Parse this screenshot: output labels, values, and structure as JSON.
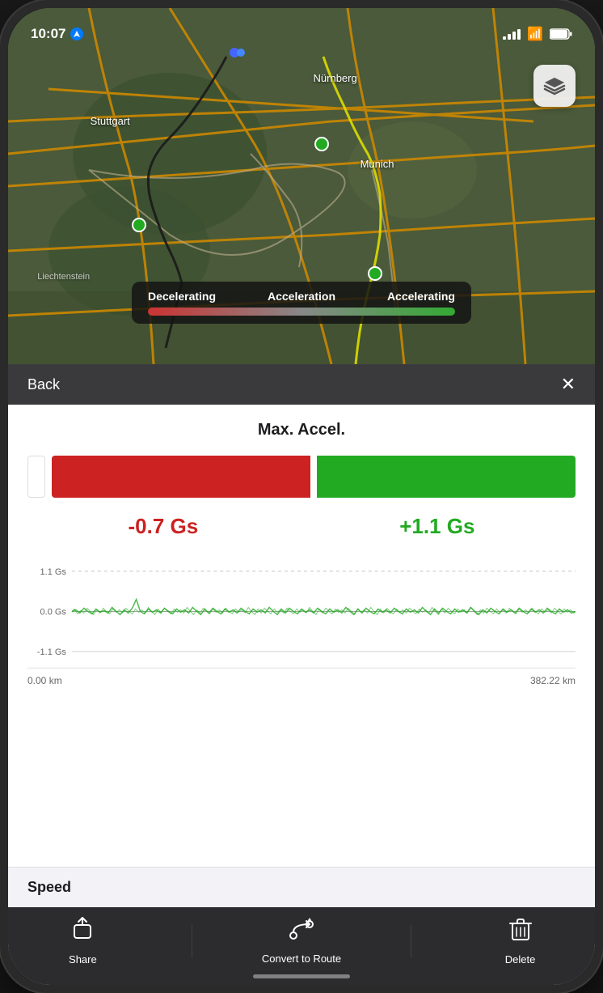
{
  "status_bar": {
    "time": "10:07",
    "signal_label": "signal",
    "wifi_label": "wifi",
    "battery_label": "battery"
  },
  "map": {
    "layers_button_label": "layers",
    "legend": {
      "decelerating": "Decelerating",
      "acceleration": "Acceleration",
      "accelerating": "Accelerating"
    },
    "city_labels": [
      {
        "name": "Nürnberg",
        "left": "52%",
        "top": "20%"
      },
      {
        "name": "Stuttgart",
        "left": "14%",
        "top": "30%"
      },
      {
        "name": "Munich",
        "left": "60%",
        "top": "42%"
      },
      {
        "name": "Liechtenstein",
        "left": "12%",
        "top": "76%"
      }
    ]
  },
  "panel_header": {
    "back_label": "Back",
    "close_label": "✕"
  },
  "accel_section": {
    "title": "Max. Accel.",
    "negative_value": "-0.7 Gs",
    "positive_value": "+1.1 Gs"
  },
  "chart": {
    "y_labels": {
      "top": "1.1 Gs",
      "middle": "0.0 Gs",
      "bottom": "-1.1 Gs"
    },
    "x_labels": {
      "left": "0.00 km",
      "right": "382.22 km"
    }
  },
  "speed_section": {
    "title": "Speed"
  },
  "toolbar": {
    "share_label": "Share",
    "convert_label": "Convert to Route",
    "delete_label": "Delete"
  }
}
